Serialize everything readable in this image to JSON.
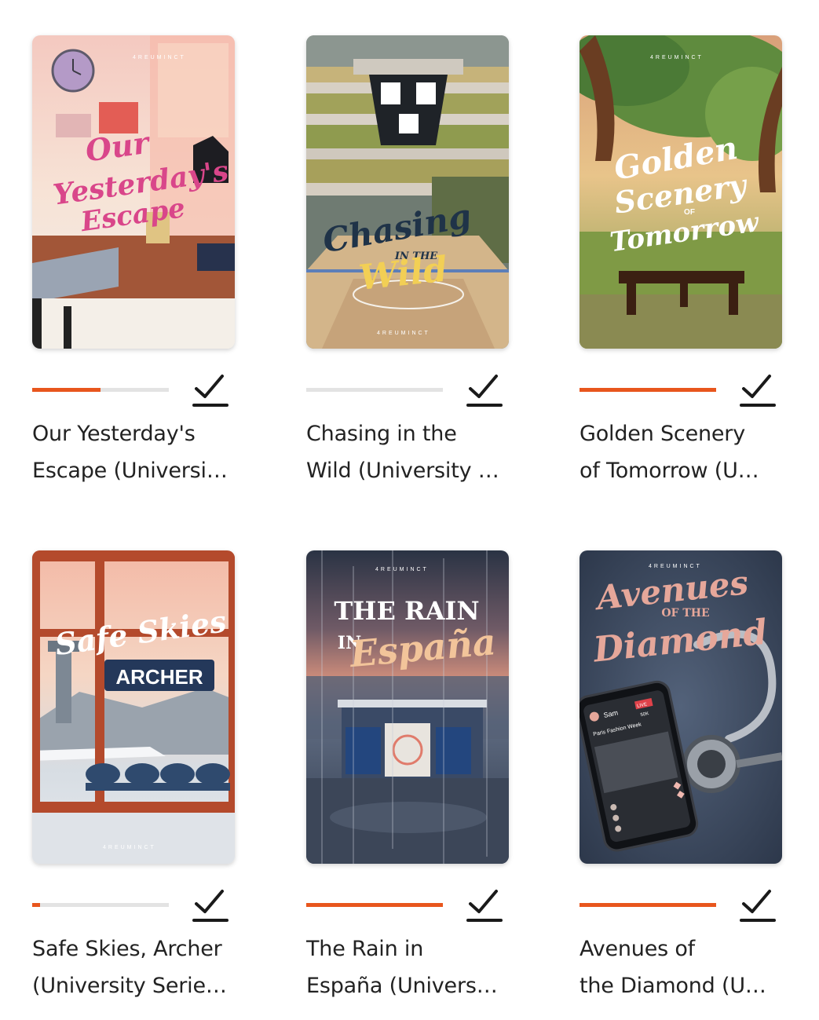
{
  "books": [
    {
      "line1": "Our Yesterday's",
      "line2": "Escape (Universi…",
      "progress": 0.5,
      "cover_text": [
        "Our",
        "Yesterday's",
        "Escape"
      ],
      "cover_brand": "4REUMINCT",
      "cover_color": "#d9468a"
    },
    {
      "line1": "Chasing in the",
      "line2": "Wild (University …",
      "progress": 0.0,
      "cover_text": [
        "Chasing",
        "IN THE",
        "Wild"
      ],
      "cover_brand": "4REUMINCT",
      "cover_color": "#1f3348"
    },
    {
      "line1": "Golden Scenery",
      "line2": "of Tomorrow (U…",
      "progress": 1.0,
      "cover_text": [
        "Golden",
        "Scenery",
        "OF",
        "Tomorrow"
      ],
      "cover_brand": "4REUMINCT",
      "cover_color": "#ffffff"
    },
    {
      "line1": "Safe Skies, Archer",
      "line2": "(University Serie…",
      "progress": 0.06,
      "cover_text": [
        "Safe Skies",
        "ARCHER"
      ],
      "cover_brand": "4REUMINCT",
      "cover_color": "#ffffff"
    },
    {
      "line1": "The Rain in",
      "line2": "España (Univers…",
      "progress": 1.0,
      "cover_text": [
        "THE RAIN",
        "IN",
        "España"
      ],
      "cover_brand": "4REUMINCT",
      "cover_color": "#f2c49a"
    },
    {
      "line1": "Avenues of",
      "line2": "the Diamond (U…",
      "progress": 1.0,
      "cover_text": [
        "Avenues",
        "OF THE",
        "Diamond"
      ],
      "cover_brand": "4REUMINCT",
      "cover_color": "#e6a79a",
      "phone_user": "Sam",
      "phone_caption": "Paris Fashion Week",
      "phone_badge": "LIVE",
      "phone_count": "50K"
    }
  ],
  "colors": {
    "accent": "#e8561d",
    "track": "#e3e3e3",
    "text": "#222222",
    "icon": "#1a1a1a"
  },
  "icons": {
    "check": "check-underline-icon"
  }
}
